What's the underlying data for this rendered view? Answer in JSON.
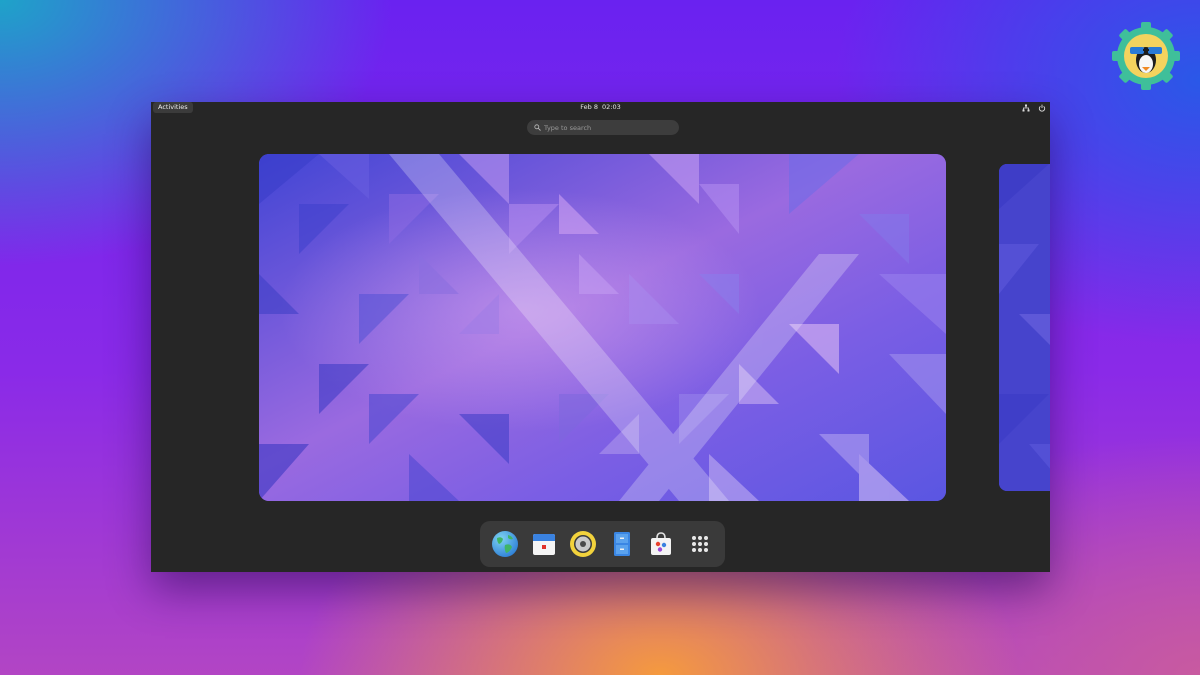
{
  "topbar": {
    "activities_label": "Activities",
    "date": "Feb 8",
    "time": "02:03",
    "tray_icons": [
      "network-icon",
      "power-icon"
    ]
  },
  "search": {
    "placeholder": "Type to search"
  },
  "dock": {
    "items": [
      {
        "name": "web-browser",
        "icon": "globe-icon"
      },
      {
        "name": "calendar",
        "icon": "calendar-icon"
      },
      {
        "name": "rhythmbox",
        "icon": "speaker-icon"
      },
      {
        "name": "file-manager",
        "icon": "file-cabinet-icon"
      },
      {
        "name": "software",
        "icon": "shopping-bag-icon"
      },
      {
        "name": "show-applications",
        "icon": "app-grid-icon"
      }
    ]
  },
  "colors": {
    "panel": "#262626",
    "dock": "#3a3a3a",
    "search_field": "#3d3d3d",
    "wallpaper_base": "#5a4fd8"
  }
}
